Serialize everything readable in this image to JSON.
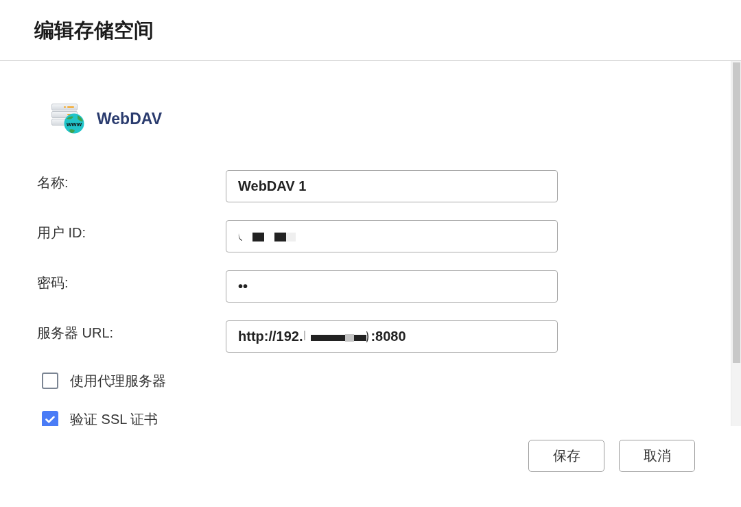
{
  "dialog": {
    "title": "编辑存储空间"
  },
  "storage": {
    "icon_text": "www",
    "type": "WebDAV"
  },
  "fields": [
    {
      "label": "名称:",
      "value": [
        {
          "kind": "text",
          "text": "WebDAV 1"
        }
      ]
    },
    {
      "label": "用户 ID:",
      "value": [
        {
          "kind": "blocks"
        }
      ]
    },
    {
      "label": "密码:",
      "value": [
        {
          "kind": "text",
          "text": "••"
        }
      ]
    },
    {
      "label": "服务器 URL:",
      "value": [
        {
          "kind": "text",
          "text": "http://192."
        },
        {
          "kind": "bar"
        },
        {
          "kind": "text",
          "text": ":8080"
        }
      ]
    }
  ],
  "options": [
    {
      "label": "使用代理服务器",
      "checked": false
    },
    {
      "label": "验证 SSL 证书",
      "checked": true
    }
  ],
  "buttons": [
    {
      "label": "保存"
    },
    {
      "label": "取消"
    }
  ]
}
